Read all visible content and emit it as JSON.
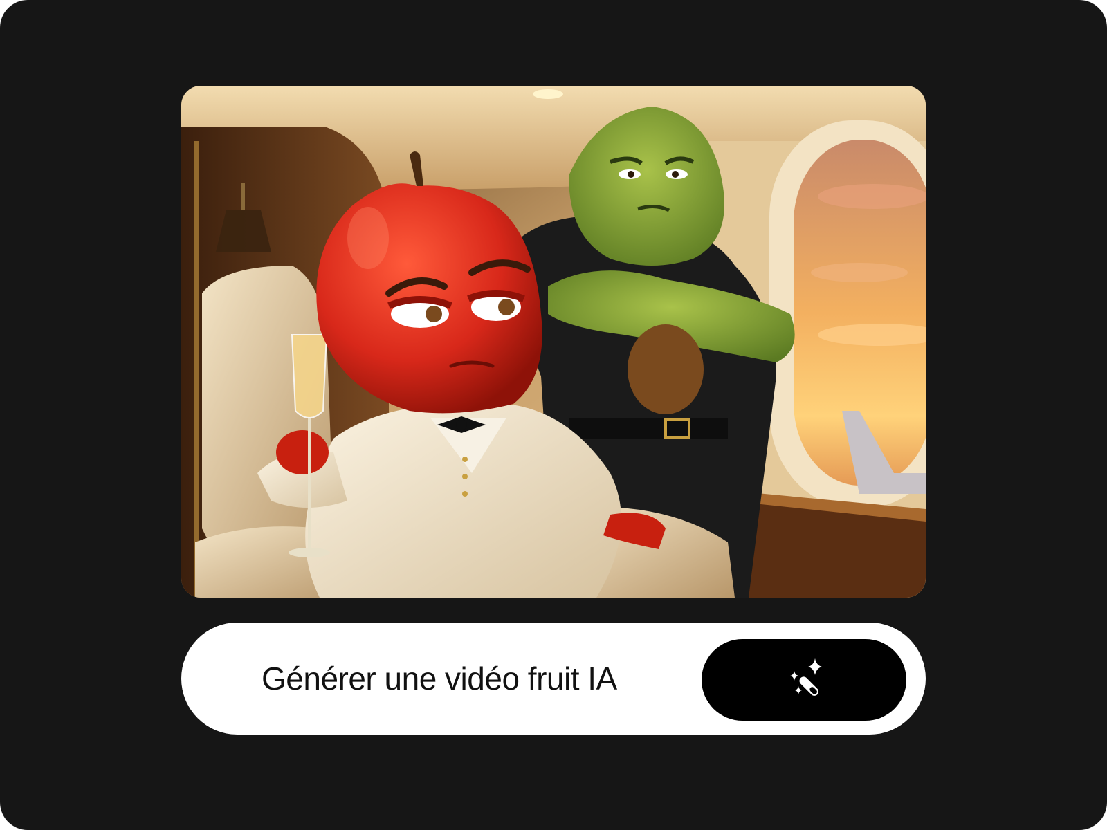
{
  "prompt": {
    "label": "Générer une vidéo fruit IA",
    "button_icon": "magic-wand-sparkles-icon"
  },
  "image": {
    "subject": "apple character in white tuxedo holding champagne, avocado bodyguard with crossed arms, private jet cabin at sunset"
  },
  "colors": {
    "background": "#161616",
    "bar": "#ffffff",
    "button": "#000000",
    "text": "#111111"
  }
}
